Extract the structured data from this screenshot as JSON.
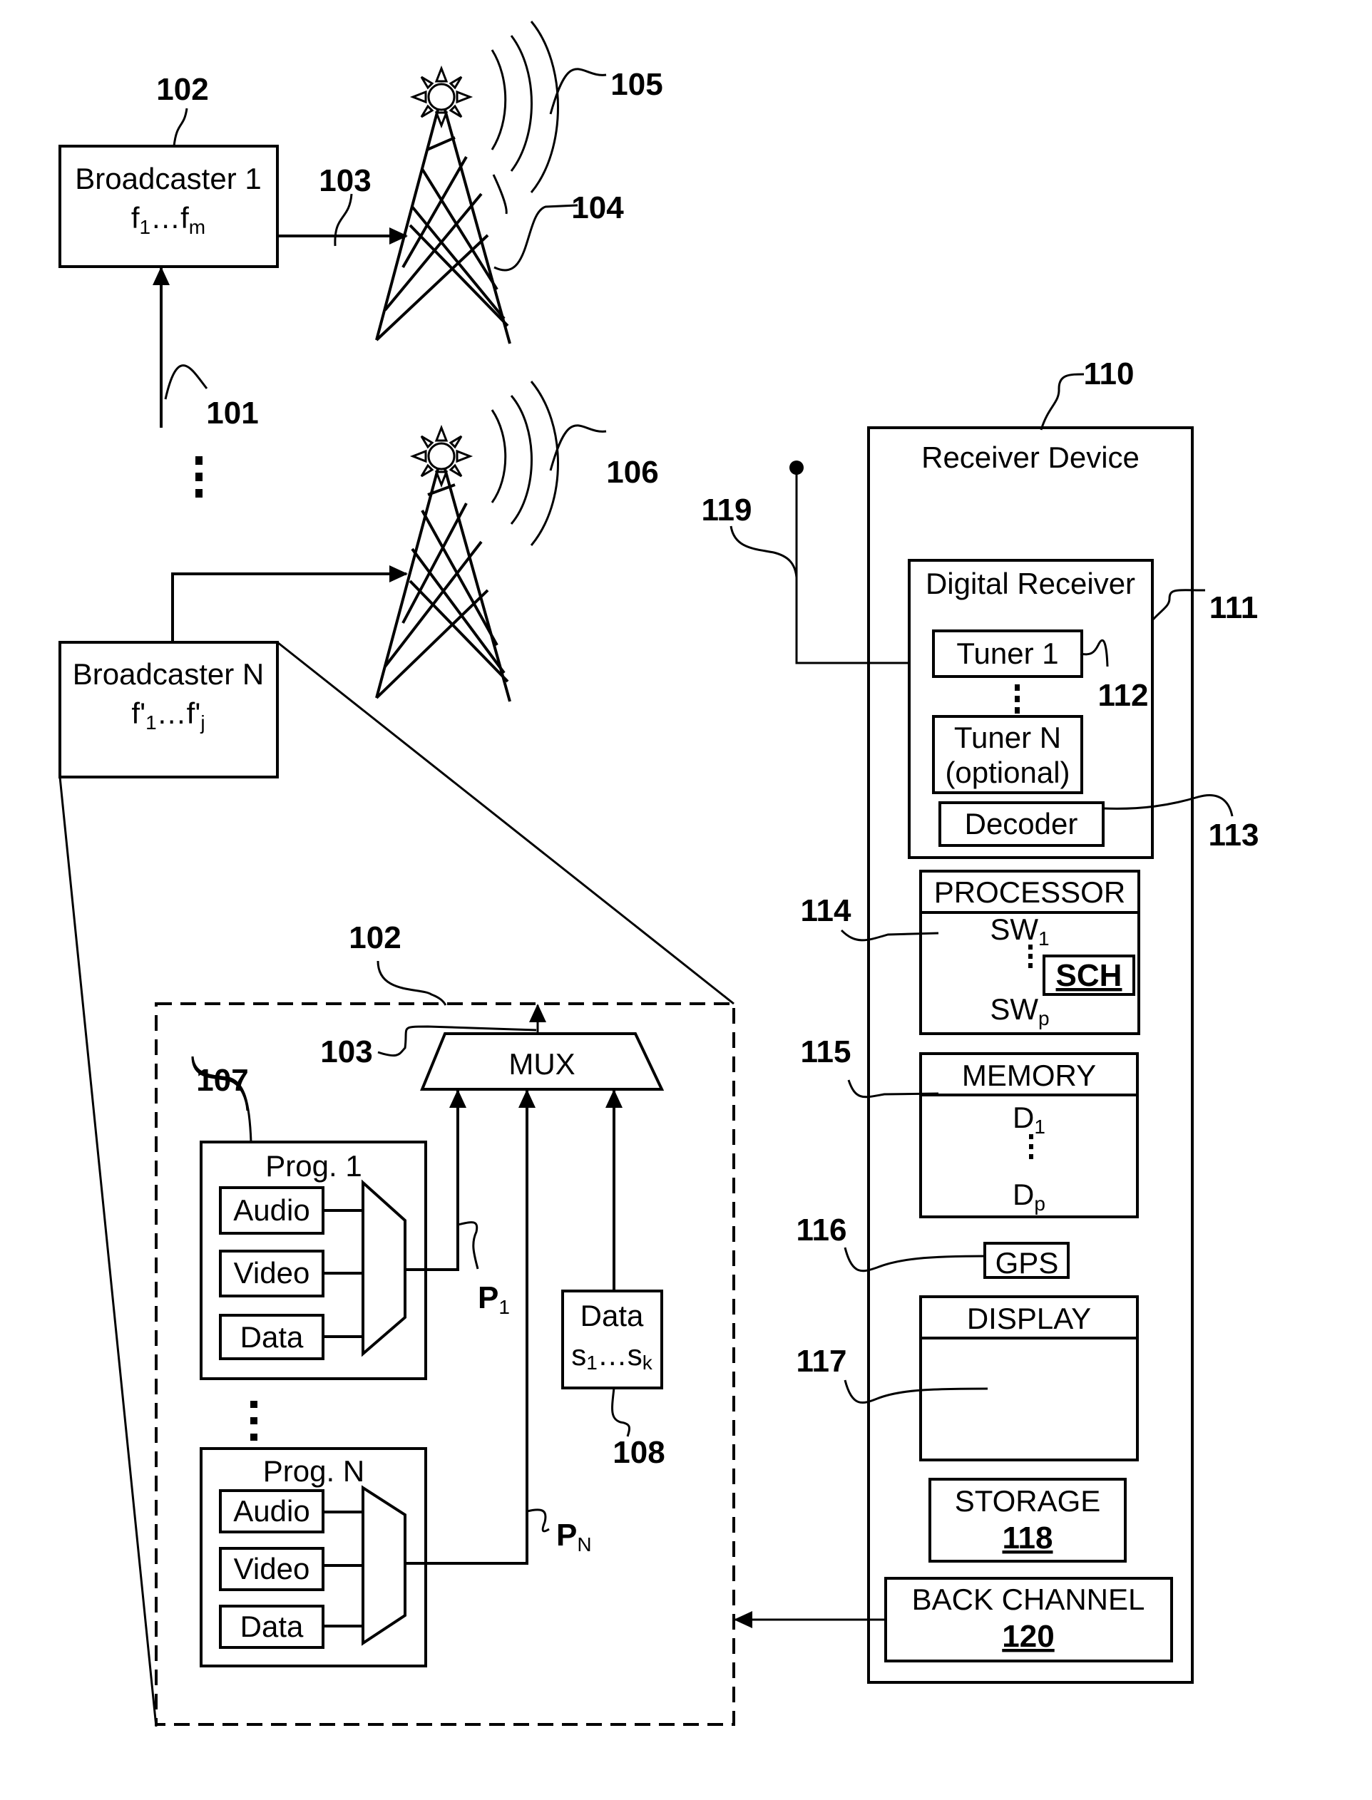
{
  "figure": {
    "ref_labels": {
      "r101": "101",
      "r102_top": "102",
      "r103_top": "103",
      "r104": "104",
      "r105": "105",
      "r106": "106",
      "r102_detail": "102",
      "r103_detail": "103",
      "r107": "107",
      "r108": "108",
      "r110": "110",
      "r111": "111",
      "r112": "112",
      "r113": "113",
      "r114": "114",
      "r115": "115",
      "r116": "116",
      "r117": "117",
      "r119": "119"
    },
    "broadcaster_1": {
      "title": "Broadcaster 1",
      "freq_base": "f",
      "freq_sub1": "1",
      "freq_dots": "…f",
      "freq_sub2": "m"
    },
    "broadcaster_n": {
      "title": "Broadcaster N",
      "freq_base": "f'",
      "freq_sub1": "1",
      "freq_dots": "…f'",
      "freq_sub2": "j"
    },
    "detail": {
      "mux_label": "MUX",
      "programs": [
        {
          "title": "Prog. 1",
          "inputs": [
            "Audio",
            "Video",
            "Data"
          ],
          "output_label": "P",
          "output_sub": "1"
        },
        {
          "title": "Prog. N",
          "inputs": [
            "Audio",
            "Video",
            "Data"
          ],
          "output_label": "P",
          "output_sub": "N"
        }
      ],
      "data_service": {
        "title": "Data",
        "range_a": "s",
        "range_a_sub": "1",
        "range_dots": "…s",
        "range_b_sub": "k"
      }
    },
    "receiver": {
      "title": "Receiver Device",
      "digital_receiver": {
        "title": "Digital Receiver",
        "tuner_1": "Tuner 1",
        "tuner_n_line1": "Tuner N",
        "tuner_n_line2": "(optional)",
        "decoder": "Decoder"
      },
      "processor": {
        "title": "PROCESSOR",
        "sw_first": "SW",
        "sw_first_sub": "1",
        "sw_last": "SW",
        "sw_last_sub": "p",
        "scheduler": "SCH"
      },
      "memory": {
        "title": "MEMORY",
        "d_first": "D",
        "d_first_sub": "1",
        "d_last": "D",
        "d_last_sub": "p"
      },
      "gps": "GPS",
      "display": "DISPLAY",
      "storage": {
        "title": "STORAGE",
        "ref": "118"
      },
      "back_channel": {
        "title": "BACK CHANNEL",
        "ref": "120"
      }
    }
  }
}
